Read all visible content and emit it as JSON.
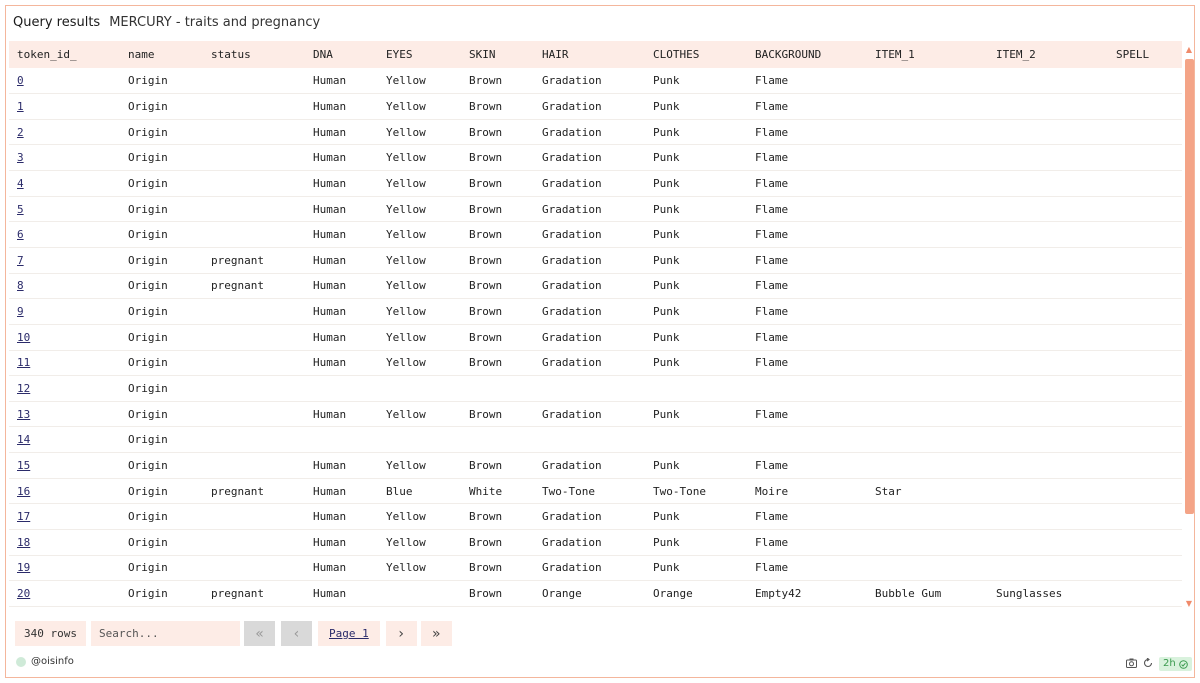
{
  "header": {
    "title": "Query results",
    "subtitle": "MERCURY - traits and pregnancy"
  },
  "table": {
    "columns": [
      "token_id_",
      "name",
      "status",
      "DNA",
      "EYES",
      "SKIN",
      "HAIR",
      "CLOTHES",
      "BACKGROUND",
      "ITEM_1",
      "ITEM_2",
      "SPELL"
    ],
    "rows": [
      [
        "0",
        "Origin",
        "",
        "Human",
        "Yellow",
        "Brown",
        "Gradation",
        "Punk",
        "Flame",
        "",
        "",
        ""
      ],
      [
        "1",
        "Origin",
        "",
        "Human",
        "Yellow",
        "Brown",
        "Gradation",
        "Punk",
        "Flame",
        "",
        "",
        ""
      ],
      [
        "2",
        "Origin",
        "",
        "Human",
        "Yellow",
        "Brown",
        "Gradation",
        "Punk",
        "Flame",
        "",
        "",
        ""
      ],
      [
        "3",
        "Origin",
        "",
        "Human",
        "Yellow",
        "Brown",
        "Gradation",
        "Punk",
        "Flame",
        "",
        "",
        ""
      ],
      [
        "4",
        "Origin",
        "",
        "Human",
        "Yellow",
        "Brown",
        "Gradation",
        "Punk",
        "Flame",
        "",
        "",
        ""
      ],
      [
        "5",
        "Origin",
        "",
        "Human",
        "Yellow",
        "Brown",
        "Gradation",
        "Punk",
        "Flame",
        "",
        "",
        ""
      ],
      [
        "6",
        "Origin",
        "",
        "Human",
        "Yellow",
        "Brown",
        "Gradation",
        "Punk",
        "Flame",
        "",
        "",
        ""
      ],
      [
        "7",
        "Origin",
        "pregnant",
        "Human",
        "Yellow",
        "Brown",
        "Gradation",
        "Punk",
        "Flame",
        "",
        "",
        ""
      ],
      [
        "8",
        "Origin",
        "pregnant",
        "Human",
        "Yellow",
        "Brown",
        "Gradation",
        "Punk",
        "Flame",
        "",
        "",
        ""
      ],
      [
        "9",
        "Origin",
        "",
        "Human",
        "Yellow",
        "Brown",
        "Gradation",
        "Punk",
        "Flame",
        "",
        "",
        ""
      ],
      [
        "10",
        "Origin",
        "",
        "Human",
        "Yellow",
        "Brown",
        "Gradation",
        "Punk",
        "Flame",
        "",
        "",
        ""
      ],
      [
        "11",
        "Origin",
        "",
        "Human",
        "Yellow",
        "Brown",
        "Gradation",
        "Punk",
        "Flame",
        "",
        "",
        ""
      ],
      [
        "12",
        "Origin",
        "",
        "",
        "",
        "",
        "",
        "",
        "",
        "",
        "",
        ""
      ],
      [
        "13",
        "Origin",
        "",
        "Human",
        "Yellow",
        "Brown",
        "Gradation",
        "Punk",
        "Flame",
        "",
        "",
        ""
      ],
      [
        "14",
        "Origin",
        "",
        "",
        "",
        "",
        "",
        "",
        "",
        "",
        "",
        ""
      ],
      [
        "15",
        "Origin",
        "",
        "Human",
        "Yellow",
        "Brown",
        "Gradation",
        "Punk",
        "Flame",
        "",
        "",
        ""
      ],
      [
        "16",
        "Origin",
        "pregnant",
        "Human",
        "Blue",
        "White",
        "Two-Tone",
        "Two-Tone",
        "Moire",
        "Star",
        "",
        ""
      ],
      [
        "17",
        "Origin",
        "",
        "Human",
        "Yellow",
        "Brown",
        "Gradation",
        "Punk",
        "Flame",
        "",
        "",
        ""
      ],
      [
        "18",
        "Origin",
        "",
        "Human",
        "Yellow",
        "Brown",
        "Gradation",
        "Punk",
        "Flame",
        "",
        "",
        ""
      ],
      [
        "19",
        "Origin",
        "",
        "Human",
        "Yellow",
        "Brown",
        "Gradation",
        "Punk",
        "Flame",
        "",
        "",
        ""
      ],
      [
        "20",
        "Origin",
        "pregnant",
        "Human",
        "",
        "Brown",
        "Orange",
        "Orange",
        "Empty42",
        "Bubble Gum",
        "Sunglasses",
        ""
      ]
    ]
  },
  "footer": {
    "rows_count": "340 rows",
    "search_placeholder": "Search...",
    "first_icon": "«",
    "prev_icon": "‹",
    "page_label": "Page 1",
    "next_icon": "›",
    "last_icon": "»"
  },
  "bottom": {
    "user": "@oisinfo",
    "age": "2h",
    "camera_icon": "camera-icon",
    "refresh_icon": "refresh-icon"
  },
  "colors": {
    "accent": "#f4a487",
    "header_bg": "#fdece6",
    "border": "#f4b69c",
    "link": "#2b2b6a"
  }
}
